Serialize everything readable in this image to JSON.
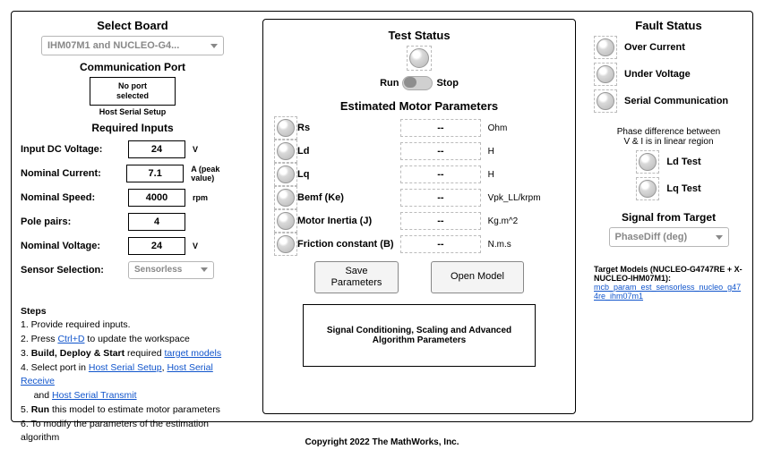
{
  "left": {
    "select_board_heading": "Select Board",
    "board_value": "IHM07M1 and NUCLEO-G4...",
    "comm_port_heading": "Communication Port",
    "port_line1": "No port",
    "port_line2": "selected",
    "host_serial_setup": "Host Serial Setup",
    "required_inputs_heading": "Required Inputs",
    "rows": {
      "dc_voltage": {
        "label": "Input DC Voltage:",
        "value": "24",
        "unit": "V"
      },
      "nominal_current": {
        "label": "Nominal Current:",
        "value": "7.1",
        "unit": "A (peak value)"
      },
      "nominal_speed": {
        "label": "Nominal Speed:",
        "value": "4000",
        "unit": "rpm"
      },
      "pole_pairs": {
        "label": "Pole pairs:",
        "value": "4",
        "unit": ""
      },
      "nominal_voltage": {
        "label": "Nominal Voltage:",
        "value": "24",
        "unit": "V"
      },
      "sensor": {
        "label": "Sensor Selection:",
        "value": "Sensorless"
      }
    }
  },
  "steps": {
    "heading": "Steps",
    "s1": "1. Provide required inputs.",
    "s2a": "2. Press ",
    "s2b": "Ctrl+D",
    "s2c": " to update the workspace",
    "s3a": "3. ",
    "s3b": "Build, Deploy & Start",
    "s3c": " required ",
    "s3d": "target models",
    "s4a": "4. Select port in ",
    "s4b": "Host Serial Setup",
    "s4c": ", ",
    "s4d": "Host Serial Receive",
    "s4e": " and ",
    "s4f": "Host Serial Transmit",
    "s5a": "5. ",
    "s5b": "Run",
    "s5c": " this model to estimate motor parameters",
    "s6": "6. To modify the parameters of the estimation algorithm"
  },
  "mid": {
    "test_status_heading": "Test Status",
    "run": "Run",
    "stop": "Stop",
    "est_heading": "Estimated Motor Parameters",
    "params": {
      "rs": {
        "name": "Rs",
        "val": "--",
        "unit": "Ohm"
      },
      "ld": {
        "name": "Ld",
        "val": "--",
        "unit": "H"
      },
      "lq": {
        "name": "Lq",
        "val": "--",
        "unit": "H"
      },
      "ke": {
        "name": "Bemf (Ke)",
        "val": "--",
        "unit": "Vpk_LL/krpm"
      },
      "j": {
        "name": "Motor Inertia (J)",
        "val": "--",
        "unit": "Kg.m^2"
      },
      "b": {
        "name": "Friction constant (B)",
        "val": "--",
        "unit": "N.m.s"
      }
    },
    "save_btn": "Save\nParameters",
    "open_btn": "Open Model",
    "subsys": "Signal Conditioning, Scaling and Advanced Algorithm Parameters"
  },
  "right": {
    "fault_heading": "Fault Status",
    "faults": {
      "oc": "Over Current",
      "uv": "Under Voltage",
      "sc": "Serial Communication"
    },
    "phase_l1": "Phase difference between",
    "phase_l2": "V & I is in linear region",
    "ld_test": "Ld Test",
    "lq_test": "Lq Test",
    "signal_heading": "Signal from Target",
    "signal_value": "PhaseDiff (deg)",
    "tm_heading": "Target Models (NUCLEO-G4747RE + X-NUCLEO-IHM07M1):",
    "tm_link": "mcb_param_est_sensorless_nucleo_g474re_ihm07m1"
  },
  "footer": "Copyright 2022 The MathWorks, Inc."
}
